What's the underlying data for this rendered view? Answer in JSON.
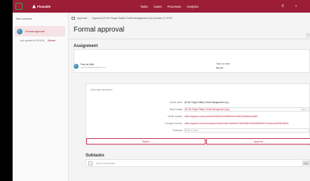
{
  "topbar": {
    "brand": "Flowable",
    "nav": [
      "Tasks",
      "Cases",
      "Processes",
      "Analytics"
    ]
  },
  "sidebar": {
    "title": "Task overview",
    "task_label": "Formal approval",
    "updated": "Last updated at 09:56:06",
    "refresh": "Refresh"
  },
  "breadcrumb": {
    "parent": "Approval",
    "current": "Approval [To Be Target State] Credit Management (cc) (version 1) 07/22"
  },
  "page": {
    "title": "Formal approval"
  },
  "assignment": {
    "title": "Assignment",
    "assignee_name": "Paul de Wild",
    "assignee_email": "paul.dewild@example.com",
    "due_label": "Task due date",
    "due_value": "Not set"
  },
  "form": {
    "description_placeholder": "Add a task description",
    "rows": [
      {
        "label": "Model name",
        "value": "[To Be Target State] Credit Management (cc)"
      },
      {
        "label": "Model image",
        "value": "[To Be Target State] Credit Management.png",
        "action": "Show"
      },
      {
        "label": "Model location",
        "value": "editor.signavio.com/p/model/4f4e6b9d31f9f5b8b4d1ae9613f0e8eba1a8e8"
      },
      {
        "label": "Compare revision",
        "value": "editor.signavio.com/p/compare/revision/4a61c3d5b5cf72af9d08621983b05884b97/revision/c8d99f1e9b3c"
      },
      {
        "label": "Feedback",
        "placeholder": "Enter a value"
      }
    ],
    "reject_label": "Reject",
    "approve_label": "Approve"
  },
  "subtasks": {
    "title": "Subtasks",
    "placeholder": "Add a new subtask",
    "add_label": "Add"
  },
  "colors": {
    "brand": "#9b1d36",
    "accent": "#c0304a"
  }
}
